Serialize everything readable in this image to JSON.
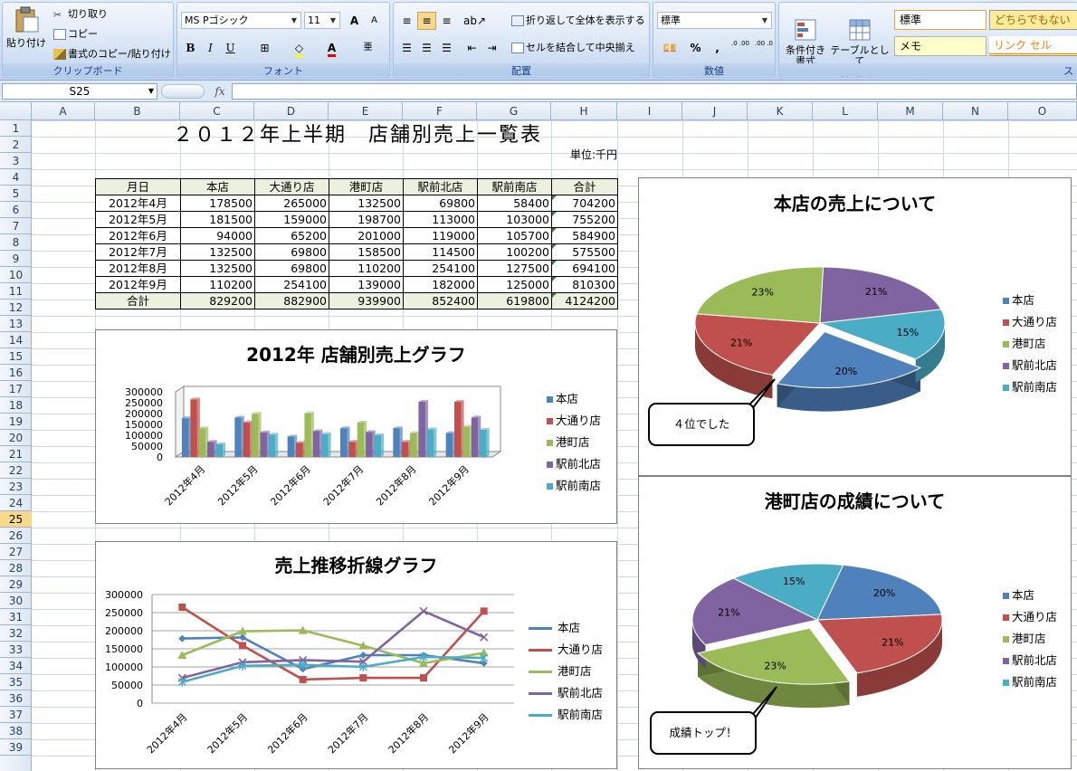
{
  "ribbon": {
    "clipboard": {
      "paste": "貼り付け",
      "cut": "切り取り",
      "copy": "コピー",
      "format_painter": "書式のコピー/貼り付け",
      "label": "クリップボード"
    },
    "font": {
      "name": "MS Pゴシック",
      "size": "11",
      "bold": "B",
      "italic": "I",
      "underline": "U",
      "font_color": "A",
      "grow": "A",
      "shrink": "A",
      "phonetic": "亜",
      "label": "フォント"
    },
    "alignment": {
      "wrap": "折り返して全体を表示する",
      "merge": "セルを結合して中央揃え",
      "label": "配置"
    },
    "number": {
      "format": "標準",
      "percent": "%",
      "comma": ",",
      "inc_decimal": ".0 .00",
      "dec_decimal": ".00 .0",
      "label": "数値"
    },
    "styles": {
      "conditional": "条件付き\n書式",
      "table": "テーブルとして\n書式設定",
      "standard": "標準",
      "neutral": "どちらでもない",
      "memo": "メモ",
      "link": "リンク セル",
      "label": "ス"
    }
  },
  "formula_bar": {
    "name_box": "S25",
    "fx": "fx",
    "value": ""
  },
  "columns": [
    "A",
    "B",
    "C",
    "D",
    "E",
    "F",
    "G",
    "H",
    "I",
    "J",
    "K",
    "L",
    "M",
    "N",
    "O"
  ],
  "rows": [
    "1",
    "2",
    "3",
    "4",
    "5",
    "6",
    "7",
    "8",
    "9",
    "10",
    "11",
    "12",
    "13",
    "14",
    "15",
    "16",
    "17",
    "18",
    "19",
    "20",
    "21",
    "22",
    "23",
    "24",
    "25",
    "26",
    "27",
    "28",
    "29",
    "30",
    "31",
    "32",
    "33",
    "34",
    "35",
    "36",
    "37",
    "38",
    "39"
  ],
  "selected_row": "25",
  "sheet": {
    "title": "２０１２年上半期　店舗別売上一覧表",
    "unit": "単位:千円",
    "table": {
      "headers": [
        "月日",
        "本店",
        "大通り店",
        "港町店",
        "駅前北店",
        "駅前南店",
        "合計"
      ],
      "rows": [
        [
          "2012年4月",
          "178500",
          "265000",
          "132500",
          "69800",
          "58400",
          "704200"
        ],
        [
          "2012年5月",
          "181500",
          "159000",
          "198700",
          "113000",
          "103000",
          "755200"
        ],
        [
          "2012年6月",
          "94000",
          "65200",
          "201000",
          "119000",
          "105700",
          "584900"
        ],
        [
          "2012年7月",
          "132500",
          "69800",
          "158500",
          "114500",
          "100200",
          "575500"
        ],
        [
          "2012年8月",
          "132500",
          "69800",
          "110200",
          "254100",
          "127500",
          "694100"
        ],
        [
          "2012年9月",
          "110200",
          "254100",
          "139000",
          "182000",
          "125000",
          "810300"
        ]
      ],
      "footer": [
        "合計",
        "829200",
        "882900",
        "939900",
        "852400",
        "619800",
        "4124200"
      ]
    }
  },
  "series_colors": [
    "#4f81bd",
    "#c0504d",
    "#9bbb59",
    "#8064a2",
    "#4bacc6"
  ],
  "chart_data": [
    {
      "type": "bar",
      "title": "2012年  店舗別売上グラフ",
      "categories": [
        "2012年4月",
        "2012年5月",
        "2012年6月",
        "2012年7月",
        "2012年8月",
        "2012年9月"
      ],
      "ylim": [
        0,
        300000
      ],
      "yticks": [
        "300000",
        "250000",
        "200000",
        "150000",
        "100000",
        "50000",
        "0"
      ],
      "legend_position": "right",
      "series": [
        {
          "name": "本店",
          "values": [
            178500,
            181500,
            94000,
            132500,
            132500,
            110200
          ]
        },
        {
          "name": "大通り店",
          "values": [
            265000,
            159000,
            65200,
            69800,
            69800,
            254100
          ]
        },
        {
          "name": "港町店",
          "values": [
            132500,
            198700,
            201000,
            158500,
            110200,
            139000
          ]
        },
        {
          "name": "駅前北店",
          "values": [
            69800,
            113000,
            119000,
            114500,
            254100,
            182000
          ]
        },
        {
          "name": "駅前南店",
          "values": [
            58400,
            103000,
            105700,
            100200,
            127500,
            125000
          ]
        }
      ]
    },
    {
      "type": "line",
      "title": "売上推移折線グラフ",
      "categories": [
        "2012年4月",
        "2012年5月",
        "2012年6月",
        "2012年7月",
        "2012年8月",
        "2012年9月"
      ],
      "ylim": [
        0,
        300000
      ],
      "yticks": [
        "300000",
        "250000",
        "200000",
        "150000",
        "100000",
        "50000",
        "0"
      ],
      "grid": true,
      "legend_position": "right",
      "series": [
        {
          "name": "本店",
          "values": [
            178500,
            181500,
            94000,
            132500,
            132500,
            110200
          ]
        },
        {
          "name": "大通り店",
          "values": [
            265000,
            159000,
            65200,
            69800,
            69800,
            254100
          ]
        },
        {
          "name": "港町店",
          "values": [
            132500,
            198700,
            201000,
            158500,
            110200,
            139000
          ]
        },
        {
          "name": "駅前北店",
          "values": [
            69800,
            113000,
            119000,
            114500,
            254100,
            182000
          ]
        },
        {
          "name": "駅前南店",
          "values": [
            58400,
            103000,
            105700,
            100200,
            127500,
            125000
          ]
        }
      ]
    },
    {
      "type": "pie",
      "title": "本店の売上について",
      "labels": [
        "本店",
        "大通り店",
        "港町店",
        "駅前北店",
        "駅前南店"
      ],
      "values": [
        829200,
        882900,
        939900,
        852400,
        619800
      ],
      "data_labels": [
        "20%",
        "21%",
        "23%",
        "21%",
        "15%"
      ],
      "exploded": "本店",
      "legend_position": "right",
      "callout": "４位でした"
    },
    {
      "type": "pie",
      "title": "港町店の成績について",
      "labels": [
        "本店",
        "大通り店",
        "港町店",
        "駅前北店",
        "駅前南店"
      ],
      "values": [
        829200,
        882900,
        939900,
        852400,
        619800
      ],
      "data_labels": [
        "20%",
        "21%",
        "23%",
        "21%",
        "15%"
      ],
      "exploded": "港町店",
      "legend_position": "right",
      "callout": "成績トップ！"
    }
  ]
}
